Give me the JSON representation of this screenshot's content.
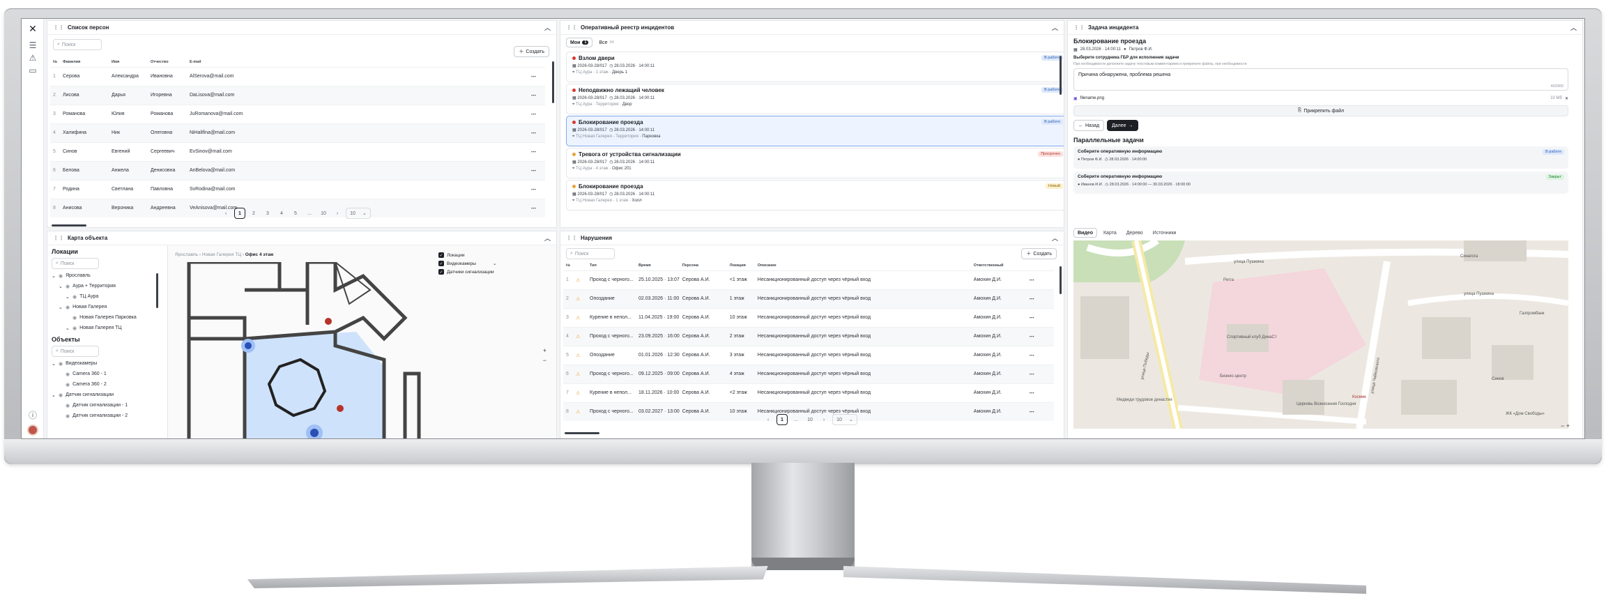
{
  "persons": {
    "title": "Список персон",
    "search_placeholder": "Поиск",
    "create_label": "Создать",
    "headers": [
      "№",
      "Фамилия",
      "Имя",
      "Отчество",
      "E-mail"
    ],
    "rows": [
      [
        "1",
        "Серова",
        "Александра",
        "Ивановна",
        "AlSerova@mail.com"
      ],
      [
        "2",
        "Лисова",
        "Дарья",
        "Игоревна",
        "DaLisova@mail.com"
      ],
      [
        "3",
        "Романова",
        "Юлия",
        "Романова",
        "JuRomanova@mail.com"
      ],
      [
        "4",
        "Халифина",
        "Ник",
        "Олеговна",
        "NiHalifina@mail.com"
      ],
      [
        "5",
        "Синов",
        "Евгений",
        "Сергеевич",
        "EvSinov@mail.com"
      ],
      [
        "6",
        "Белова",
        "Анжела",
        "Денисовна",
        "AnBelova@mail.com"
      ],
      [
        "7",
        "Родина",
        "Светлана",
        "Павловна",
        "SvRodina@mail.com"
      ],
      [
        "8",
        "Анисова",
        "Вероника",
        "Андреевна",
        "VeAnisova@mail.com"
      ]
    ],
    "pages": [
      "1",
      "2",
      "3",
      "4",
      "5",
      "...",
      "10"
    ],
    "page_size": "10"
  },
  "incidents": {
    "title": "Оперативный реестр инцидентов",
    "tab_mine": "Мои",
    "tab_mine_count": "1",
    "tab_all": "Все",
    "tab_all_count": "34",
    "cards": [
      {
        "title": "Взлом двери",
        "id": "2026-03-28/017",
        "date": "28.03.2026 · 14:00:11",
        "place": "ТЦ Аура",
        "floor": "1 этаж",
        "room": "Дверь 1",
        "status": "В работе",
        "status_kind": "work",
        "prio": "#d93a2f"
      },
      {
        "title": "Неподвижно лежащий человек",
        "id": "2026-03-28/017",
        "date": "28.03.2026 · 14:00:11",
        "place": "ТЦ Аура",
        "floor": "Территория",
        "room": "Двор",
        "status": "В работе",
        "status_kind": "work",
        "prio": "#d93a2f"
      },
      {
        "title": "Блокирование проезда",
        "id": "2026-03-28/017",
        "date": "28.03.2026 · 14:00:11",
        "place": "ТЦ Новая Галерея",
        "floor": "Территория",
        "room": "Парковка",
        "status": "В работе",
        "status_kind": "work",
        "prio": "#d93a2f"
      },
      {
        "title": "Тревога от устройства сигнализации",
        "id": "2026-03-28/017",
        "date": "28.03.2026 · 14:00:11",
        "place": "ТЦ Аура",
        "floor": "4 этаж",
        "room": "Офис 201",
        "status": "Просрочен",
        "status_kind": "over",
        "prio": "#e8a33d"
      },
      {
        "title": "Блокирование проезда",
        "id": "2026-03-28/017",
        "date": "28.03.2026 · 14:00:11",
        "place": "ТЦ Новая Галерея",
        "floor": "1 этаж",
        "room": "Холл",
        "status": "Новый",
        "status_kind": "new",
        "prio": "#e8a33d"
      }
    ]
  },
  "task": {
    "title": "Задача инцидента",
    "incident_title": "Блокирование проезда",
    "incident_date": "28.03.2026 · 14:00:11",
    "incident_person": "Петров Ф.И.",
    "select_label": "Выберите сотрудника ГБР для исполнения задачи",
    "select_hint": "При необходимости дополните задачу текстовым комментарием и прикрепите файлы, при необходимости",
    "comment": "Причина обнаружена, проблема решена",
    "counter": "40/2000",
    "file_name": "filename.png",
    "file_size": "10 Мб",
    "attach_label": "Прикрепить файл",
    "back_label": "Назад",
    "next_label": "Далее",
    "parallel_title": "Параллельные задачи",
    "parallel": [
      {
        "title": "Соберите оперативную информацию",
        "person": "Петров Ф.И.",
        "date": "28.03.2026 · 14:00:00",
        "status": "В работе",
        "status_kind": "work"
      },
      {
        "title": "Соберите оперативную информацию",
        "person": "Иванов И.И.",
        "date": "28.03.2026 · 14:00:00 — 30.03.2026 · 18:00:00",
        "status": "Закрыт",
        "status_kind": "done"
      }
    ],
    "map_tabs": [
      "Видео",
      "Карта",
      "Дерево",
      "Источники"
    ]
  },
  "object_map": {
    "title": "Карта объекта",
    "locations_title": "Локации",
    "search_placeholder": "Поиск",
    "locations": [
      "Ярославль",
      "Аура + Территория",
      "ТЦ Аура",
      "Новая Галерея",
      "Новая Галерея Парковка",
      "Новая Галерея ТЦ"
    ],
    "objects_title": "Объекты",
    "objects": [
      "Видеокамеры",
      "Camera 360 - 1",
      "Camera 360 - 2",
      "Датчик сигнализации",
      "Датчик сигнализации - 1",
      "Датчик сигнализации - 2"
    ],
    "breadcrumb": [
      "Ярославль",
      "Новая Галерея ТЦ",
      "Офис 4 этаж"
    ],
    "legend": [
      "Локации",
      "Видеокамеры",
      "Датчики сигнализации"
    ]
  },
  "violations": {
    "title": "Нарушения",
    "search_placeholder": "Поиск",
    "create_label": "Создать",
    "headers": [
      "№",
      "Тип",
      "Время",
      "Персона",
      "Локация",
      "Описание",
      "Ответственный"
    ],
    "rows": [
      [
        "1",
        "Проход с черного...",
        "25.10.2025 · 13:07",
        "Серова А.И.",
        "<1 этаж",
        "Несанкционированный доступ через чёрный вход",
        "Амохин Д.И."
      ],
      [
        "2",
        "Опоздание",
        "02.03.2026 · 11:00",
        "Серова А.И.",
        "1 этаж",
        "Несанкционированный доступ через чёрный вход",
        "Амохин Д.И."
      ],
      [
        "3",
        "Курение в непол...",
        "11.04.2025 · 19:00",
        "Серова А.И.",
        "10 этаж",
        "Несанкционированный доступ через чёрный вход",
        "Амохин Д.И."
      ],
      [
        "4",
        "Проход с черного...",
        "23.09.2025 · 16:00",
        "Серова А.И.",
        "2 этаж",
        "Несанкционированный доступ через чёрный вход",
        "Амохин Д.И."
      ],
      [
        "5",
        "Опоздание",
        "01.01.2026 · 12:30",
        "Серова А.И.",
        "3 этаж",
        "Несанкционированный доступ через чёрный вход",
        "Амохин Д.И."
      ],
      [
        "6",
        "Проход с черного...",
        "09.12.2025 · 09:00",
        "Серова А.И.",
        "4 этаж",
        "Несанкционированный доступ через чёрный вход",
        "Амохин Д.И."
      ],
      [
        "7",
        "Курение в непол...",
        "18.11.2026 · 10:00",
        "Серова А.И.",
        "<2 этаж",
        "Несанкционированный доступ через чёрный вход",
        "Амохин Д.И."
      ],
      [
        "8",
        "Проход с черного...",
        "03.02.2027 · 13:00",
        "Серова А.И.",
        "10 этаж",
        "Несанкционированный доступ через чёрный вход",
        "Амохин Д.И."
      ]
    ],
    "pages": [
      "1",
      "...",
      "10"
    ],
    "page_size": "10"
  },
  "city_map": {
    "streets": [
      "улица Пушкина",
      "улица Пушкина",
      "улица Победы",
      "улица Чайковского"
    ],
    "labels": [
      "Синагога",
      "Ригга",
      "Спортивный клуб ДинаСт",
      "Бизнес-центр",
      "Медведи трудовое династия",
      "Церковь Вознесения Господня",
      "Космик",
      "Газпромбанк",
      "ЖК «Дом Свободы»",
      "Синов"
    ],
    "colors": {
      "park": "#c8dfb8",
      "pink": "#f4d6dd",
      "road": "#ffffff",
      "base": "#ece8e1",
      "building": "#d9d4cc"
    }
  }
}
